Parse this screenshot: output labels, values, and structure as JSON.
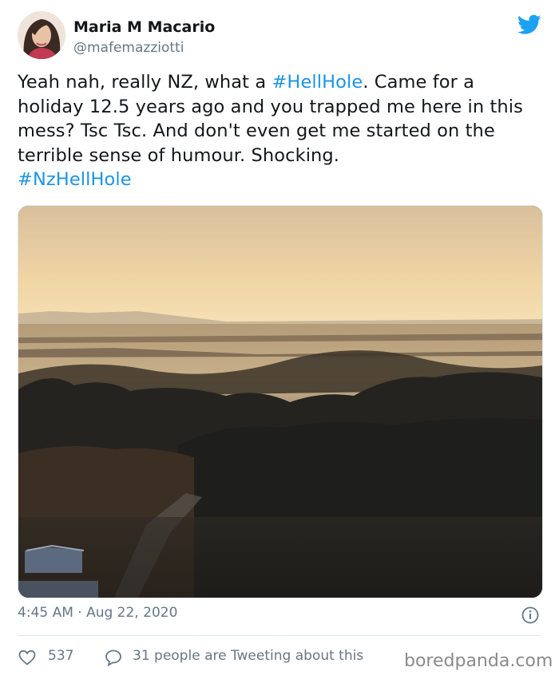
{
  "tweet": {
    "author_name": "Maria M Macario",
    "author_handle": "@mafemazziotti",
    "text_part1": "Yeah nah, really NZ, what a ",
    "hashtag1": "#HellHole",
    "text_part2": ". Came for a holiday 12.5 years ago and you trapped me here in this mess? Tsc Tsc. And don't even get me started on the terrible sense of humour. Shocking.",
    "hashtag2": "#NzHellHole",
    "timestamp": "4:45 AM · Aug 22, 2020",
    "likes": "537",
    "talking": "31 people are Tweeting about this"
  },
  "watermark": "boredpanda.com",
  "icons": {
    "brand": "twitter-bird-icon",
    "like": "heart-icon",
    "reply": "speech-bubble-icon",
    "info": "info-icon"
  },
  "colors": {
    "link": "#1b95e0",
    "brand": "#1da1f2",
    "muted": "#657786"
  }
}
